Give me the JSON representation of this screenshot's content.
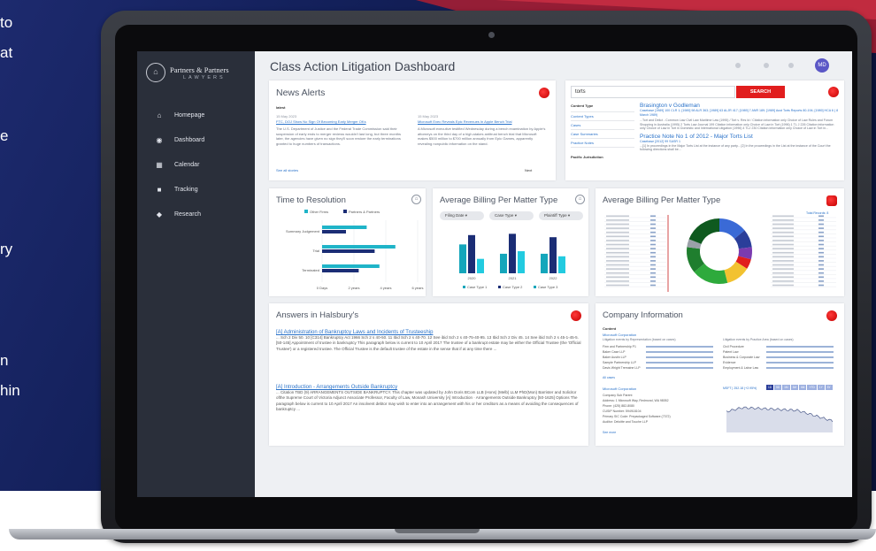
{
  "side_text": [
    "to",
    "at",
    "e",
    "ry",
    "n",
    "hin"
  ],
  "colors": {
    "accent": "#1b2d75",
    "teal": "#1fb4c8",
    "red": "#e11d1d",
    "link": "#2a72c9",
    "sidebar": "#2a2f3a"
  },
  "sidebar": {
    "logo_name": "Partners & Partners",
    "logo_sub": "LAWYERS",
    "items": [
      {
        "label": "Homepage",
        "icon": "home-icon"
      },
      {
        "label": "Dashboard",
        "icon": "dashboard-icon"
      },
      {
        "label": "Calendar",
        "icon": "calendar-icon"
      },
      {
        "label": "Tracking",
        "icon": "tracking-icon"
      },
      {
        "label": "Research",
        "icon": "research-icon"
      }
    ]
  },
  "header": {
    "title": "Class Action Litigation Dashboard",
    "avatar": "MD"
  },
  "news": {
    "title": "News Alerts",
    "tag": "latest",
    "items": [
      {
        "date": "15 May 2023",
        "headline": "FTC, DOJ Show No Sign Of Becoming Early Merger OKs",
        "body": "The U.S. Department of Justice and the Federal Trade Commission said their suspension of early ends to merger reviews wouldn't last long, but three months later, the agencies have given no sign they'll soon restore the early terminations granted to huge numbers of transactions."
      },
      {
        "date": "15 May 2023",
        "headline": "Microsoft Exec Reveals Epic Revenues In Apple Bench Trial",
        "body": "A Microsoft executive testified Wednesday during a bench examination by Apple's attorneys on the third day of a high-stakes antitrust bench trial that Microsoft makes $500 million to $700 million annually from Epic Games, apparently revealing nonpublic information on the stand."
      }
    ],
    "see_all": "See all stories",
    "next": "Next"
  },
  "search": {
    "query": "torts",
    "button": "SEARCH",
    "filters": [
      "Content Type",
      "Content Types",
      "Cases",
      "Case Summaries",
      "Practice Notes"
    ],
    "filter2": "Pacific Jurisdiction",
    "results": [
      {
        "title": "Brasington v Godleman",
        "meta": "Casebase [1989] 100 CLR 1; [1989] 98 ALR 363; [1989] 63 ALJR 417; [1989] 7 ANR 189; [1989] Aust Torts Reports 80-194; [1989] HCA 6 ( 8 March 1989)",
        "body": "...Tort and Delict - Common Law Civil Law Maritime Law (1995) / Tort v. Res Id / Citation information only Choice of Law Rules and Forum Shopping in Australia (1995) 2 Torts Law Journal 199 Citation information only Choice of Law in Tort (1996) 1 TL J 226 Citation information only Choice of Law in Tort in Domestic and International Litigation (1996) 4 TLJ 230 Citation information only Choice of Law in Tort in..."
      },
      {
        "title": "Practice Note No 1 of 2012 - Major Torts List",
        "meta": "Casebase [2012] 99 SASR 1",
        "body": "...[1] In proceedings in the Major Torts List at the instance of any party... [2] In the proceedings in the List at the instance of the Court the following directions shall be..."
      }
    ]
  },
  "resolution": {
    "title": "Time to Resolution",
    "legend": [
      "Other Firms",
      "Partners & Partners"
    ],
    "x_ticks": [
      "0 Days",
      "2 years",
      "4 years",
      "6 years"
    ]
  },
  "billing1": {
    "title": "Average Billing Per Matter Type",
    "filters": [
      "Filing Date",
      "Case Type",
      "Plaintiff Type"
    ],
    "legend": [
      "Case Type 1",
      "Case Type 2",
      "Case Type 3"
    ]
  },
  "billing2": {
    "title": "Average Billing Per Matter Type",
    "count": "Total Records: 8"
  },
  "chart_data": [
    {
      "type": "bar",
      "orientation": "horizontal",
      "title": "Time to Resolution",
      "categories": [
        "Summary Judgement",
        "Trial",
        "Terminated"
      ],
      "x_ticks": [
        "0 Days",
        "2 years",
        "4 years",
        "6 years"
      ],
      "xlim": [
        0,
        6
      ],
      "series": [
        {
          "name": "Other Firms",
          "values": [
            2.8,
            4.6,
            3.6
          ]
        },
        {
          "name": "Partners & Partners",
          "values": [
            1.5,
            3.3,
            2.3
          ]
        }
      ]
    },
    {
      "type": "bar",
      "title": "Average Billing Per Matter Type",
      "categories": [
        "2020",
        "2021",
        "2022"
      ],
      "ylim": [
        0,
        100
      ],
      "series": [
        {
          "name": "Case Type 1",
          "values": [
            68,
            46,
            46
          ]
        },
        {
          "name": "Case Type 2",
          "values": [
            90,
            93,
            85
          ]
        },
        {
          "name": "Case Type 3",
          "values": [
            34,
            52,
            40
          ]
        }
      ]
    },
    {
      "type": "pie",
      "title": "Average Billing Per Matter Type",
      "values": [
        14,
        9,
        6,
        5,
        12,
        18,
        13,
        4,
        19
      ],
      "colors": [
        "#3a6ad6",
        "#2a3e9a",
        "#7b3bb0",
        "#e11d1d",
        "#f2c230",
        "#2eaa3c",
        "#1f7e2e",
        "#9aa0a8",
        "#0f5a1f"
      ]
    }
  ],
  "halsbury": {
    "title": "Answers in Halsbury's",
    "items": [
      {
        "title": "[A] Administration of Bankruptcy Laws and Incidents of Trusteeship",
        "body": "... Sch 2 Div 50.  10 [C314] Bankruptcy Act 1966 Sch 2 s 40-50.  11 Ibid Sch 2 s 40-70.  12 See ibid Sch 2 s 40-75-40-95.  13 Ibid Sch 2 Div 45.  14 See ibid Sch 2 s 45-1-45-5. [50-145] Appointment of trustee in bankruptcy This paragraph below is current to 10 April 2017 The trustee of a bankrupt estate may be either the Official Trustee (the 'Official Trustee') or a registered trustee. The Official Trustee is the default trustee of the estate in the sense that if at any time there ..."
      },
      {
        "title": "[A] Introduction - Arrangements Outside Bankruptcy",
        "body": "... Citation TBD (9) ARRANGEMENTS OUTSIDE BANKRUPTCY.  This chapter was updated by John Doris BCom LLB (Hons) (Melb) LLM PhD(Mon) Barrister and Solicitor ofthe Supreme Court of Victoria Adjunct Associate Professor, Faculty of Law, Monash University  [A] Introduction · Arrangements Outside Bankruptcy [50-1625] Options The paragraph below is current to 10 April 2017 An insolvent debtor may wish to enter into an arrangement with his or her creditors as a means of avoiding the consequences of bankruptcy ..."
      }
    ]
  },
  "company": {
    "title": "Company Information",
    "section": "Content",
    "name": "Microsoft Corporation",
    "label_a": "Litigation events by Representation (based on cases)",
    "label_b": "Litigation events by Practice Area (based on cases)",
    "rows_a": [
      "Firm and Partnership P1",
      "Baker Case LLP",
      "Baker Austin LLP",
      "Sample Partnership LLP",
      "Davis Wright Tremaine LLP"
    ],
    "rows_b": [
      "Civil Procedure",
      "Patent Law",
      "Business & Corporate Law",
      "Evidence",
      "Employment & Labor Law"
    ],
    "all_cases": "All cases",
    "name2": "Microsoft Corporation",
    "details": [
      "Company Sub Parent",
      "Address: 1 Microsoft Way, Redmond, WA 98052",
      "Phone: (425) 882-8080",
      "CUSIP Number: 594918104",
      "Primary SIC Code: Prepackaged Software (7372)",
      "Auditor: Deloitte and Touche LLP"
    ],
    "see_more": "See more",
    "stock_label": "MSFT | 252.18 (+2.95%)",
    "ranges": [
      "1D",
      "5D",
      "1M",
      "3M",
      "6M",
      "YTD",
      "1Y",
      "5Y"
    ]
  }
}
